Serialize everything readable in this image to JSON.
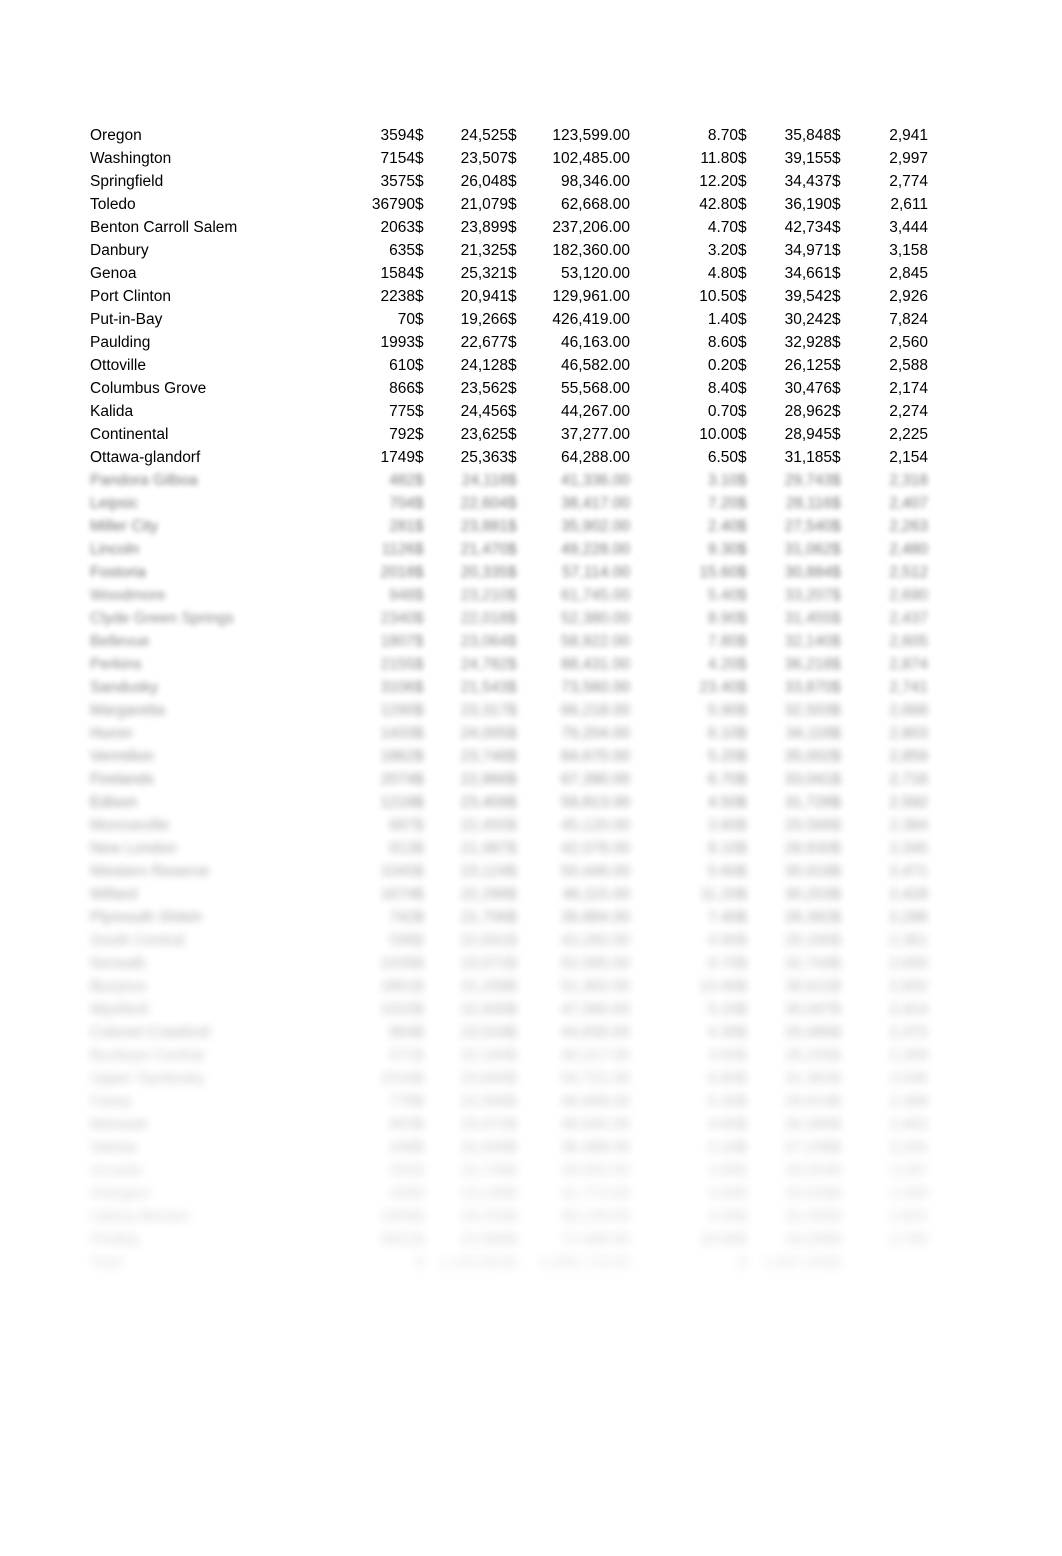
{
  "document": {
    "kind": "spreadsheet-data-table",
    "background_color": "#ffffff",
    "text_color": "#000000",
    "currency_symbol": "$"
  },
  "table": {
    "columns": [
      {
        "key": "name",
        "align": "left",
        "label": ""
      },
      {
        "key": "count",
        "align": "right",
        "label": ""
      },
      {
        "key": "cur1",
        "align": "left",
        "label": ""
      },
      {
        "key": "val1",
        "align": "right",
        "label": ""
      },
      {
        "key": "cur2",
        "align": "left",
        "label": ""
      },
      {
        "key": "val2",
        "align": "right",
        "label": ""
      },
      {
        "key": "pct",
        "align": "right",
        "label": ""
      },
      {
        "key": "cur3",
        "align": "left",
        "label": ""
      },
      {
        "key": "val3",
        "align": "right",
        "label": ""
      },
      {
        "key": "cur4",
        "align": "left",
        "label": ""
      },
      {
        "key": "val4",
        "align": "right",
        "label": ""
      }
    ],
    "rows": [
      {
        "name": "Oregon",
        "count": "3594",
        "cur1": "$",
        "val1": "24,525",
        "cur2": "$",
        "val2": "123,599.00",
        "pct": "8.70",
        "cur3": "$",
        "val3": "35,848",
        "cur4": "$",
        "val4": "2,941",
        "blur": 0
      },
      {
        "name": "Washington",
        "count": "7154",
        "cur1": "$",
        "val1": "23,507",
        "cur2": "$",
        "val2": "102,485.00",
        "pct": "11.80",
        "cur3": "$",
        "val3": "39,155",
        "cur4": "$",
        "val4": "2,997",
        "blur": 0
      },
      {
        "name": "Springfield",
        "count": "3575",
        "cur1": "$",
        "val1": "26,048",
        "cur2": "$",
        "val2": "98,346.00",
        "pct": "12.20",
        "cur3": "$",
        "val3": "34,437",
        "cur4": "$",
        "val4": "2,774",
        "blur": 0
      },
      {
        "name": "Toledo",
        "count": "36790",
        "cur1": "$",
        "val1": "21,079",
        "cur2": "$",
        "val2": "62,668.00",
        "pct": "42.80",
        "cur3": "$",
        "val3": "36,190",
        "cur4": "$",
        "val4": "2,611",
        "blur": 0
      },
      {
        "name": "Benton Carroll Salem",
        "count": "2063",
        "cur1": "$",
        "val1": "23,899",
        "cur2": "$",
        "val2": "237,206.00",
        "pct": "4.70",
        "cur3": "$",
        "val3": "42,734",
        "cur4": "$",
        "val4": "3,444",
        "blur": 0
      },
      {
        "name": "Danbury",
        "count": "635",
        "cur1": "$",
        "val1": "21,325",
        "cur2": "$",
        "val2": "182,360.00",
        "pct": "3.20",
        "cur3": "$",
        "val3": "34,971",
        "cur4": "$",
        "val4": "3,158",
        "blur": 0
      },
      {
        "name": "Genoa",
        "count": "1584",
        "cur1": "$",
        "val1": "25,321",
        "cur2": "$",
        "val2": "53,120.00",
        "pct": "4.80",
        "cur3": "$",
        "val3": "34,661",
        "cur4": "$",
        "val4": "2,845",
        "blur": 0
      },
      {
        "name": "Port Clinton",
        "count": "2238",
        "cur1": "$",
        "val1": "20,941",
        "cur2": "$",
        "val2": "129,961.00",
        "pct": "10.50",
        "cur3": "$",
        "val3": "39,542",
        "cur4": "$",
        "val4": "2,926",
        "blur": 0
      },
      {
        "name": "Put-in-Bay",
        "count": "70",
        "cur1": "$",
        "val1": "19,266",
        "cur2": "$",
        "val2": "426,419.00",
        "pct": "1.40",
        "cur3": "$",
        "val3": "30,242",
        "cur4": "$",
        "val4": "7,824",
        "blur": 0
      },
      {
        "name": "Paulding",
        "count": "1993",
        "cur1": "$",
        "val1": "22,677",
        "cur2": "$",
        "val2": "46,163.00",
        "pct": "8.60",
        "cur3": "$",
        "val3": "32,928",
        "cur4": "$",
        "val4": "2,560",
        "blur": 0
      },
      {
        "name": "Ottoville",
        "count": "610",
        "cur1": "$",
        "val1": "24,128",
        "cur2": "$",
        "val2": "46,582.00",
        "pct": "0.20",
        "cur3": "$",
        "val3": "26,125",
        "cur4": "$",
        "val4": "2,588",
        "blur": 0
      },
      {
        "name": "Columbus Grove",
        "count": "866",
        "cur1": "$",
        "val1": "23,562",
        "cur2": "$",
        "val2": "55,568.00",
        "pct": "8.40",
        "cur3": "$",
        "val3": "30,476",
        "cur4": "$",
        "val4": "2,174",
        "blur": 0
      },
      {
        "name": "Kalida",
        "count": "775",
        "cur1": "$",
        "val1": "24,456",
        "cur2": "$",
        "val2": "44,267.00",
        "pct": "0.70",
        "cur3": "$",
        "val3": "28,962",
        "cur4": "$",
        "val4": "2,274",
        "blur": 0
      },
      {
        "name": "Continental",
        "count": "792",
        "cur1": "$",
        "val1": "23,625",
        "cur2": "$",
        "val2": "37,277.00",
        "pct": "10.00",
        "cur3": "$",
        "val3": "28,945",
        "cur4": "$",
        "val4": "2,225",
        "blur": 0
      },
      {
        "name": "Ottawa-glandorf",
        "count": "1749",
        "cur1": "$",
        "val1": "25,363",
        "cur2": "$",
        "val2": "64,288.00",
        "pct": "6.50",
        "cur3": "$",
        "val3": "31,185",
        "cur4": "$",
        "val4": "2,154",
        "blur": 0
      },
      {
        "name": "Pandora Gilboa",
        "count": "482",
        "cur1": "$",
        "val1": "24,118",
        "cur2": "$",
        "val2": "41,336.00",
        "pct": "3.10",
        "cur3": "$",
        "val3": "29,743",
        "cur4": "$",
        "val4": "2,318",
        "blur": 1
      },
      {
        "name": "Leipsic",
        "count": "704",
        "cur1": "$",
        "val1": "22,604",
        "cur2": "$",
        "val2": "38,417.00",
        "pct": "7.20",
        "cur3": "$",
        "val3": "28,116",
        "cur4": "$",
        "val4": "2,407",
        "blur": 1
      },
      {
        "name": "Miller City",
        "count": "281",
        "cur1": "$",
        "val1": "23,881",
        "cur2": "$",
        "val2": "35,902.00",
        "pct": "2.40",
        "cur3": "$",
        "val3": "27,540",
        "cur4": "$",
        "val4": "2,263",
        "blur": 1
      },
      {
        "name": "Lincoln",
        "count": "1126",
        "cur1": "$",
        "val1": "21,470",
        "cur2": "$",
        "val2": "49,228.00",
        "pct": "9.30",
        "cur3": "$",
        "val3": "31,062",
        "cur4": "$",
        "val4": "2,480",
        "blur": 1
      },
      {
        "name": "Fostoria",
        "count": "2018",
        "cur1": "$",
        "val1": "20,335",
        "cur2": "$",
        "val2": "57,114.00",
        "pct": "15.60",
        "cur3": "$",
        "val3": "30,884",
        "cur4": "$",
        "val4": "2,512",
        "blur": 1
      },
      {
        "name": "Woodmore",
        "count": "948",
        "cur1": "$",
        "val1": "23,210",
        "cur2": "$",
        "val2": "61,745.00",
        "pct": "5.40",
        "cur3": "$",
        "val3": "33,207",
        "cur4": "$",
        "val4": "2,690",
        "blur": 2
      },
      {
        "name": "Clyde Green Springs",
        "count": "2340",
        "cur1": "$",
        "val1": "22,018",
        "cur2": "$",
        "val2": "52,380.00",
        "pct": "8.90",
        "cur3": "$",
        "val3": "31,455",
        "cur4": "$",
        "val4": "2,437",
        "blur": 2
      },
      {
        "name": "Bellevue",
        "count": "1807",
        "cur1": "$",
        "val1": "23,064",
        "cur2": "$",
        "val2": "58,922.00",
        "pct": "7.80",
        "cur3": "$",
        "val3": "32,140",
        "cur4": "$",
        "val4": "2,605",
        "blur": 2
      },
      {
        "name": "Perkins",
        "count": "2155",
        "cur1": "$",
        "val1": "24,782",
        "cur2": "$",
        "val2": "88,431.00",
        "pct": "4.20",
        "cur3": "$",
        "val3": "36,218",
        "cur4": "$",
        "val4": "2,874",
        "blur": 2
      },
      {
        "name": "Sandusky",
        "count": "3106",
        "cur1": "$",
        "val1": "21,543",
        "cur2": "$",
        "val2": "73,560.00",
        "pct": "23.40",
        "cur3": "$",
        "val3": "33,870",
        "cur4": "$",
        "val4": "2,741",
        "blur": 2
      },
      {
        "name": "Margaretta",
        "count": "1290",
        "cur1": "$",
        "val1": "23,317",
        "cur2": "$",
        "val2": "66,218.00",
        "pct": "5.90",
        "cur3": "$",
        "val3": "32,503",
        "cur4": "$",
        "val4": "2,668",
        "blur": 3
      },
      {
        "name": "Huron",
        "count": "1433",
        "cur1": "$",
        "val1": "24,005",
        "cur2": "$",
        "val2": "79,204.00",
        "pct": "6.10",
        "cur3": "$",
        "val3": "34,118",
        "cur4": "$",
        "val4": "2,803",
        "blur": 3
      },
      {
        "name": "Vermilion",
        "count": "1862",
        "cur1": "$",
        "val1": "23,748",
        "cur2": "$",
        "val2": "84,670.00",
        "pct": "5.20",
        "cur3": "$",
        "val3": "35,002",
        "cur4": "$",
        "val4": "2,859",
        "blur": 3
      },
      {
        "name": "Firelands",
        "count": "2074",
        "cur1": "$",
        "val1": "22,866",
        "cur2": "$",
        "val2": "67,390.00",
        "pct": "6.70",
        "cur3": "$",
        "val3": "33,041",
        "cur4": "$",
        "val4": "2,716",
        "blur": 3
      },
      {
        "name": "Edison",
        "count": "1218",
        "cur1": "$",
        "val1": "23,409",
        "cur2": "$",
        "val2": "59,813.00",
        "pct": "4.50",
        "cur3": "$",
        "val3": "31,728",
        "cur4": "$",
        "val4": "2,592",
        "blur": 3
      },
      {
        "name": "Monroeville",
        "count": "687",
        "cur1": "$",
        "val1": "22,450",
        "cur2": "$",
        "val2": "45,120.00",
        "pct": "3.80",
        "cur3": "$",
        "val3": "29,566",
        "cur4": "$",
        "val4": "2,384",
        "blur": 4
      },
      {
        "name": "New London",
        "count": "913",
        "cur1": "$",
        "val1": "21,987",
        "cur2": "$",
        "val2": "42,078.00",
        "pct": "8.10",
        "cur3": "$",
        "val3": "28,830",
        "cur4": "$",
        "val4": "2,345",
        "blur": 4
      },
      {
        "name": "Western Reserve",
        "count": "1045",
        "cur1": "$",
        "val1": "23,124",
        "cur2": "$",
        "val2": "50,446.00",
        "pct": "5.60",
        "cur3": "$",
        "val3": "30,918",
        "cur4": "$",
        "val4": "2,471",
        "blur": 4
      },
      {
        "name": "Willard",
        "count": "1674",
        "cur1": "$",
        "val1": "22,298",
        "cur2": "$",
        "val2": "48,115.00",
        "pct": "11.20",
        "cur3": "$",
        "val3": "30,203",
        "cur4": "$",
        "val4": "2,428",
        "blur": 4
      },
      {
        "name": "Plymouth Shiloh",
        "count": "742",
        "cur1": "$",
        "val1": "21,706",
        "cur2": "$",
        "val2": "39,884.00",
        "pct": "7.40",
        "cur3": "$",
        "val3": "28,392",
        "cur4": "$",
        "val4": "2,296",
        "blur": 4
      },
      {
        "name": "South Central",
        "count": "598",
        "cur1": "$",
        "val1": "22,841",
        "cur2": "$",
        "val2": "43,260.00",
        "pct": "4.90",
        "cur3": "$",
        "val3": "29,180",
        "cur4": "$",
        "val4": "2,361",
        "blur": 5
      },
      {
        "name": "Norwalk",
        "count": "2436",
        "cur1": "$",
        "val1": "23,672",
        "cur2": "$",
        "val2": "62,995.00",
        "pct": "9.70",
        "cur3": "$",
        "val3": "32,744",
        "cur4": "$",
        "val4": "2,650",
        "blur": 5
      },
      {
        "name": "Bucyrus",
        "count": "1851",
        "cur1": "$",
        "val1": "21,258",
        "cur2": "$",
        "val2": "51,302.00",
        "pct": "13.40",
        "cur3": "$",
        "val3": "30,611",
        "cur4": "$",
        "val4": "2,502",
        "blur": 5
      },
      {
        "name": "Wynford",
        "count": "1022",
        "cur1": "$",
        "val1": "22,930",
        "cur2": "$",
        "val2": "47,560.00",
        "pct": "5.10",
        "cur3": "$",
        "val3": "30,047",
        "cur4": "$",
        "val4": "2,414",
        "blur": 5
      },
      {
        "name": "Colonel Crawford",
        "count": "864",
        "cur1": "$",
        "val1": "23,518",
        "cur2": "$",
        "val2": "44,830.00",
        "pct": "4.30",
        "cur3": "$",
        "val3": "29,486",
        "cur4": "$",
        "val4": "2,372",
        "blur": 5
      },
      {
        "name": "Buckeye Central",
        "count": "571",
        "cur1": "$",
        "val1": "22,164",
        "cur2": "$",
        "val2": "40,217.00",
        "pct": "3.60",
        "cur3": "$",
        "val3": "28,205",
        "cur4": "$",
        "val4": "2,308",
        "blur": 6
      },
      {
        "name": "Upper Sandusky",
        "count": "1516",
        "cur1": "$",
        "val1": "23,840",
        "cur2": "$",
        "val2": "54,721.00",
        "pct": "6.80",
        "cur3": "$",
        "val3": "31,362",
        "cur4": "$",
        "val4": "2,546",
        "blur": 6
      },
      {
        "name": "Carey",
        "count": "778",
        "cur1": "$",
        "val1": "22,506",
        "cur2": "$",
        "val2": "46,908.00",
        "pct": "5.30",
        "cur3": "$",
        "val3": "29,914",
        "cur4": "$",
        "val4": "2,398",
        "blur": 6
      },
      {
        "name": "Mohawk",
        "count": "903",
        "cur1": "$",
        "val1": "23,072",
        "cur2": "$",
        "val2": "49,645.00",
        "pct": "4.60",
        "cur3": "$",
        "val3": "30,380",
        "cur4": "$",
        "val4": "2,452",
        "blur": 6
      },
      {
        "name": "Vanlue",
        "count": "246",
        "cur1": "$",
        "val1": "21,630",
        "cur2": "$",
        "val2": "36,488.00",
        "pct": "2.10",
        "cur3": "$",
        "val3": "27,236",
        "cur4": "$",
        "val4": "2,241",
        "blur": 6
      },
      {
        "name": "Arcadia",
        "count": "392",
        "cur1": "$",
        "val1": "22,748",
        "cur2": "$",
        "val2": "38,950.00",
        "pct": "2.80",
        "cur3": "$",
        "val3": "28,054",
        "cur4": "$",
        "val4": "2,287",
        "blur": 7
      },
      {
        "name": "Arlington",
        "count": "435",
        "cur1": "$",
        "val1": "23,196",
        "cur2": "$",
        "val2": "41,772.00",
        "pct": "3.00",
        "cur3": "$",
        "val3": "29,028",
        "cur4": "$",
        "val4": "2,330",
        "blur": 7
      },
      {
        "name": "Liberty Benton",
        "count": "1084",
        "cur1": "$",
        "val1": "24,310",
        "cur2": "$",
        "val2": "56,134.00",
        "pct": "4.00",
        "cur3": "$",
        "val3": "32,265",
        "cur4": "$",
        "val4": "2,622",
        "blur": 7
      },
      {
        "name": "Findlay",
        "count": "5821",
        "cur1": "$",
        "val1": "22,985",
        "cur2": "$",
        "val2": "71,406.00",
        "pct": "18.90",
        "cur3": "$",
        "val3": "34,290",
        "cur4": "$",
        "val4": "2,760",
        "blur": 7
      },
      {
        "name": "Total",
        "count": "",
        "cur1": "$",
        "val1": "1,154,862",
        "cur2": "$",
        "val2": "4,298,715.00",
        "pct": "",
        "cur3": "$",
        "val3": "1,587,430",
        "cur4": "$",
        "val4": "",
        "blur": 8
      }
    ]
  }
}
